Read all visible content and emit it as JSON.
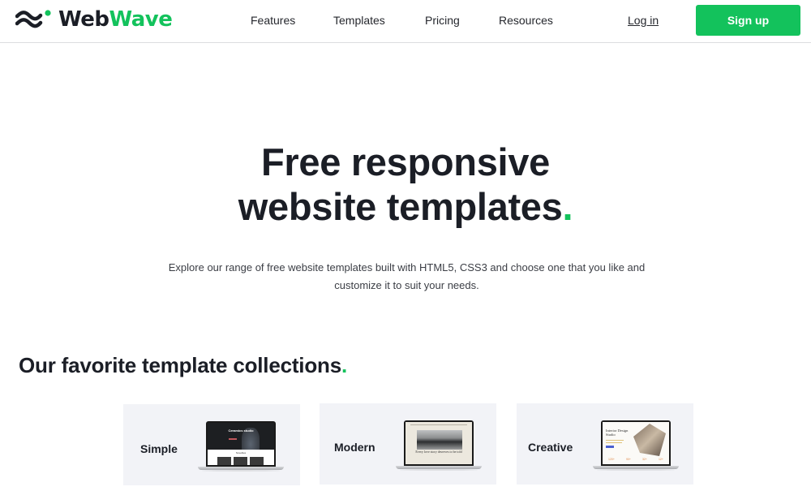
{
  "header": {
    "brand": {
      "part1": "Web",
      "part2": "Wave"
    },
    "nav": [
      {
        "label": "Features"
      },
      {
        "label": "Templates"
      },
      {
        "label": "Pricing"
      },
      {
        "label": "Resources"
      }
    ],
    "login_label": "Log in",
    "signup_label": "Sign up"
  },
  "hero": {
    "title_line1": "Free responsive",
    "title_line2": "website templates",
    "title_dot": ".",
    "subtitle": "Explore our range of free website templates built with HTML5, CSS3 and choose one that you like and customize it to suit your needs."
  },
  "collections": {
    "title": "Our favorite template collections",
    "title_dot": ".",
    "cards": [
      {
        "label": "Simple",
        "preview": {
          "headline": "Ceramics studio",
          "section": "Novelties"
        }
      },
      {
        "label": "Modern",
        "preview": {
          "caption": "Every love story deserves to be told"
        }
      },
      {
        "label": "Creative",
        "preview": {
          "headline": "Interior Design Studio",
          "stats": [
            "120+",
            "90+",
            "32+",
            "12+"
          ]
        }
      }
    ]
  },
  "colors": {
    "accent": "#13c25c",
    "text": "#1b1e26",
    "card_bg": "#f2f3f7"
  }
}
